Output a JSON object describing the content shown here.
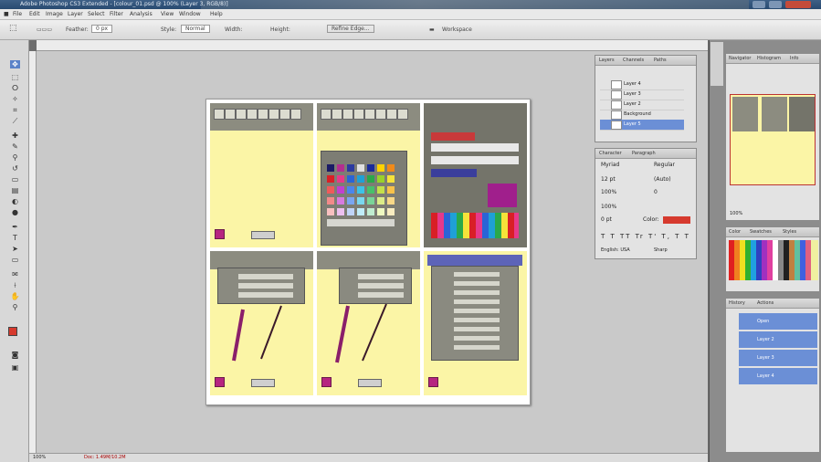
{
  "app": {
    "title": "Adobe Photoshop CS3 Extended - [colour_01.psd @ 100% (Layer 3, RGB/8)]"
  },
  "menu": [
    "File",
    "Edit",
    "Image",
    "Layer",
    "Select",
    "Filter",
    "Analysis",
    "View",
    "Window",
    "Help"
  ],
  "options": {
    "feather_label": "Feather:",
    "feather_value": "0 px",
    "style_label": "Style:",
    "style_value": "Normal",
    "width_label": "Width:",
    "height_label": "Height:",
    "refine_label": "Refine Edge...",
    "workspace_label": "Workspace"
  },
  "layers_panel": {
    "tabs": [
      "Layers",
      "Channels",
      "Paths"
    ],
    "layers": [
      "Layer 4",
      "Layer 3",
      "Layer 2",
      "Background"
    ]
  },
  "character_panel": {
    "tabs": [
      "Character",
      "Paragraph"
    ],
    "font": "Myriad",
    "font_style": "Regular",
    "size": "12 pt",
    "leading": "(Auto)",
    "tracking": "0",
    "scale_v": "100%",
    "scale_h": "100%",
    "baseline": "0 pt",
    "color_label": "Color:",
    "language": "English: USA",
    "antialias": "Sharp"
  },
  "navigator": {
    "tabs": [
      "Navigator",
      "Histogram",
      "Info"
    ],
    "zoom": "100%"
  },
  "swatches": {
    "tabs": [
      "Color",
      "Swatches",
      "Styles"
    ]
  },
  "history": {
    "tabs": [
      "History",
      "Actions"
    ],
    "items": [
      "Open",
      "Layer 2",
      "Layer 3",
      "Layer 4"
    ]
  },
  "status": {
    "zoom": "100%",
    "doc": "Doc: 1.49M/10.2M"
  },
  "colors": {
    "accent": "#b62580",
    "selection": "#6b8fd6",
    "canvas_bg": "#fbf5a6"
  }
}
